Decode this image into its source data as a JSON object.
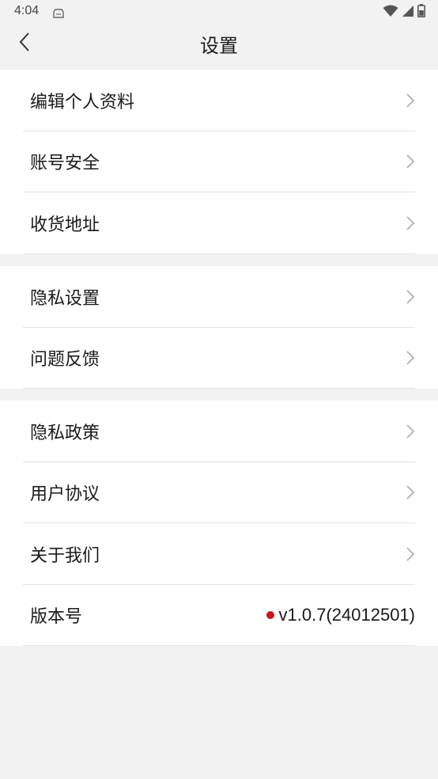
{
  "status_bar": {
    "time": "4:04"
  },
  "nav": {
    "title": "设置"
  },
  "sections": [
    {
      "items": [
        {
          "label": "编辑个人资料"
        },
        {
          "label": "账号安全"
        },
        {
          "label": "收货地址"
        }
      ]
    },
    {
      "items": [
        {
          "label": "隐私设置"
        },
        {
          "label": "问题反馈"
        }
      ]
    },
    {
      "items": [
        {
          "label": "隐私政策"
        },
        {
          "label": "用户协议"
        },
        {
          "label": "关于我们"
        },
        {
          "label": "版本号",
          "value": "v1.0.7(24012501)"
        }
      ]
    }
  ],
  "colors": {
    "background": "#f2f2f2",
    "card": "#ffffff",
    "divider": "#e3e3e3",
    "chevron": "#b0b0b0",
    "update_dot": "#c8161d"
  },
  "icons": {
    "back": "chevron-left-icon",
    "row_arrow": "chevron-right-icon",
    "status": [
      "storage-icon",
      "wifi-icon",
      "signal-icon",
      "battery-icon"
    ]
  }
}
